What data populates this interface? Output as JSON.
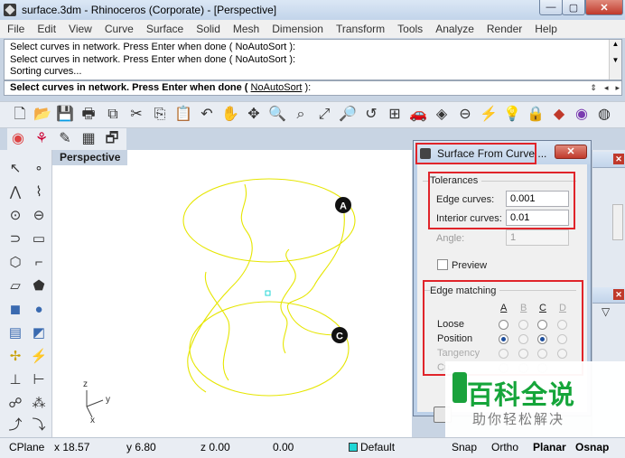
{
  "window": {
    "title": "surface.3dm - Rhinoceros (Corporate) - [Perspective]",
    "min_glyph": "—",
    "max_glyph": "▢",
    "close_glyph": "✕"
  },
  "menu": [
    "File",
    "Edit",
    "View",
    "Curve",
    "Surface",
    "Solid",
    "Mesh",
    "Dimension",
    "Transform",
    "Tools",
    "Analyze",
    "Render",
    "Help"
  ],
  "command_history": [
    "Select curves in network. Press Enter when done ( NoAutoSort ):",
    "Select curves in network. Press Enter when done ( NoAutoSort ):",
    "Sorting curves..."
  ],
  "command_prompt": {
    "text": "Select curves in network. Press Enter when done (",
    "option": "NoAutoSort",
    "suffix": " ):"
  },
  "viewport": {
    "title": "Perspective",
    "markers": [
      "A",
      "C"
    ],
    "axes": {
      "z": "z",
      "y": "y",
      "x": "x"
    },
    "curve_color": "#e6e600"
  },
  "dialog": {
    "title": "Surface From Curve ...",
    "close_glyph": "✕",
    "tolerances": {
      "group_label": "Tolerances",
      "edge_label": "Edge curves:",
      "edge_value": "0.001",
      "interior_label": "Interior curves:",
      "interior_value": "0.01",
      "angle_label": "Angle:",
      "angle_value": "1"
    },
    "preview_label": "Preview",
    "preview_checked": false,
    "edge_matching": {
      "group_label": "Edge matching",
      "columns": [
        "A",
        "B",
        "C",
        "D"
      ],
      "rows": [
        {
          "label": "Loose",
          "selected_col": -1,
          "enabled_cols": [
            true,
            false,
            true,
            false
          ],
          "row_enabled": true
        },
        {
          "label": "Position",
          "selected_col": 0,
          "enabled_cols": [
            true,
            false,
            true,
            false
          ],
          "selected_cols": [
            0,
            2
          ],
          "row_enabled": true
        },
        {
          "label": "Tangency",
          "enabled_cols": [
            false,
            false,
            false,
            false
          ],
          "row_enabled": false
        },
        {
          "label": "Cu",
          "enabled_cols": [
            false,
            false,
            false,
            false
          ],
          "row_enabled": false
        }
      ]
    }
  },
  "watermark": {
    "title": "百科全说",
    "subtitle": "助你轻松解决"
  },
  "statusbar": {
    "cplane": "CPlane",
    "x": "x 18.57",
    "y": "y 6.80",
    "z": "z 0.00",
    "d": "0.00",
    "layer": "Default",
    "snap": "Snap",
    "ortho": "Ortho",
    "planar": "Planar",
    "osnap": "Osnap",
    "layer_color": "#1fd6d6"
  },
  "colors": {
    "highlight": "#e0242a",
    "radio_selected": "#1e4e9c",
    "viewport_title_bg": "#c7d3e2"
  }
}
